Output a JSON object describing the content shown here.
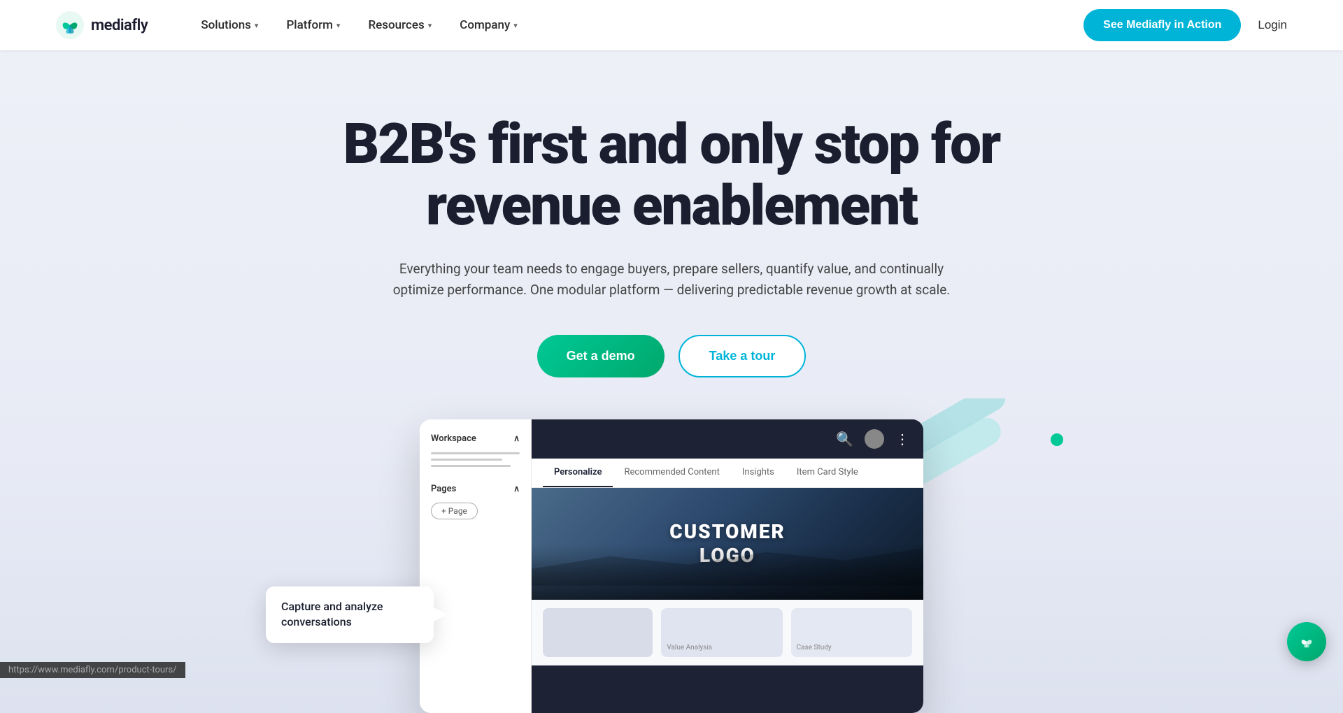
{
  "brand": {
    "name": "mediafly",
    "logo_alt": "Mediafly logo"
  },
  "nav": {
    "solutions_label": "Solutions",
    "platform_label": "Platform",
    "resources_label": "Resources",
    "company_label": "Company",
    "cta_label": "See Mediafly in Action",
    "login_label": "Login"
  },
  "hero": {
    "title": "B2B's first and only stop for revenue enablement",
    "subtitle": "Everything your team needs to engage buyers, prepare sellers, quantify value, and continually optimize performance. One modular platform — delivering predictable revenue growth at scale.",
    "demo_button": "Get a demo",
    "tour_button": "Take a tour"
  },
  "mockup": {
    "sidebar": {
      "workspace_label": "Workspace",
      "pages_label": "Pages",
      "add_page_label": "+ Page"
    },
    "tabs": [
      {
        "label": "Personalize",
        "active": true
      },
      {
        "label": "Recommended Content",
        "active": false
      },
      {
        "label": "Insights",
        "active": false
      },
      {
        "label": "Item Card Style",
        "active": false
      }
    ],
    "customer_logo": "CUSTOMER\nLOGO"
  },
  "tooltip": {
    "text": "Capture and analyze conversations"
  },
  "url_bar": {
    "text": "https://www.mediafly.com/product-tours/"
  },
  "cards": [
    {
      "label": ""
    },
    {
      "label": "Value Analysis"
    },
    {
      "label": "Case Study"
    }
  ]
}
